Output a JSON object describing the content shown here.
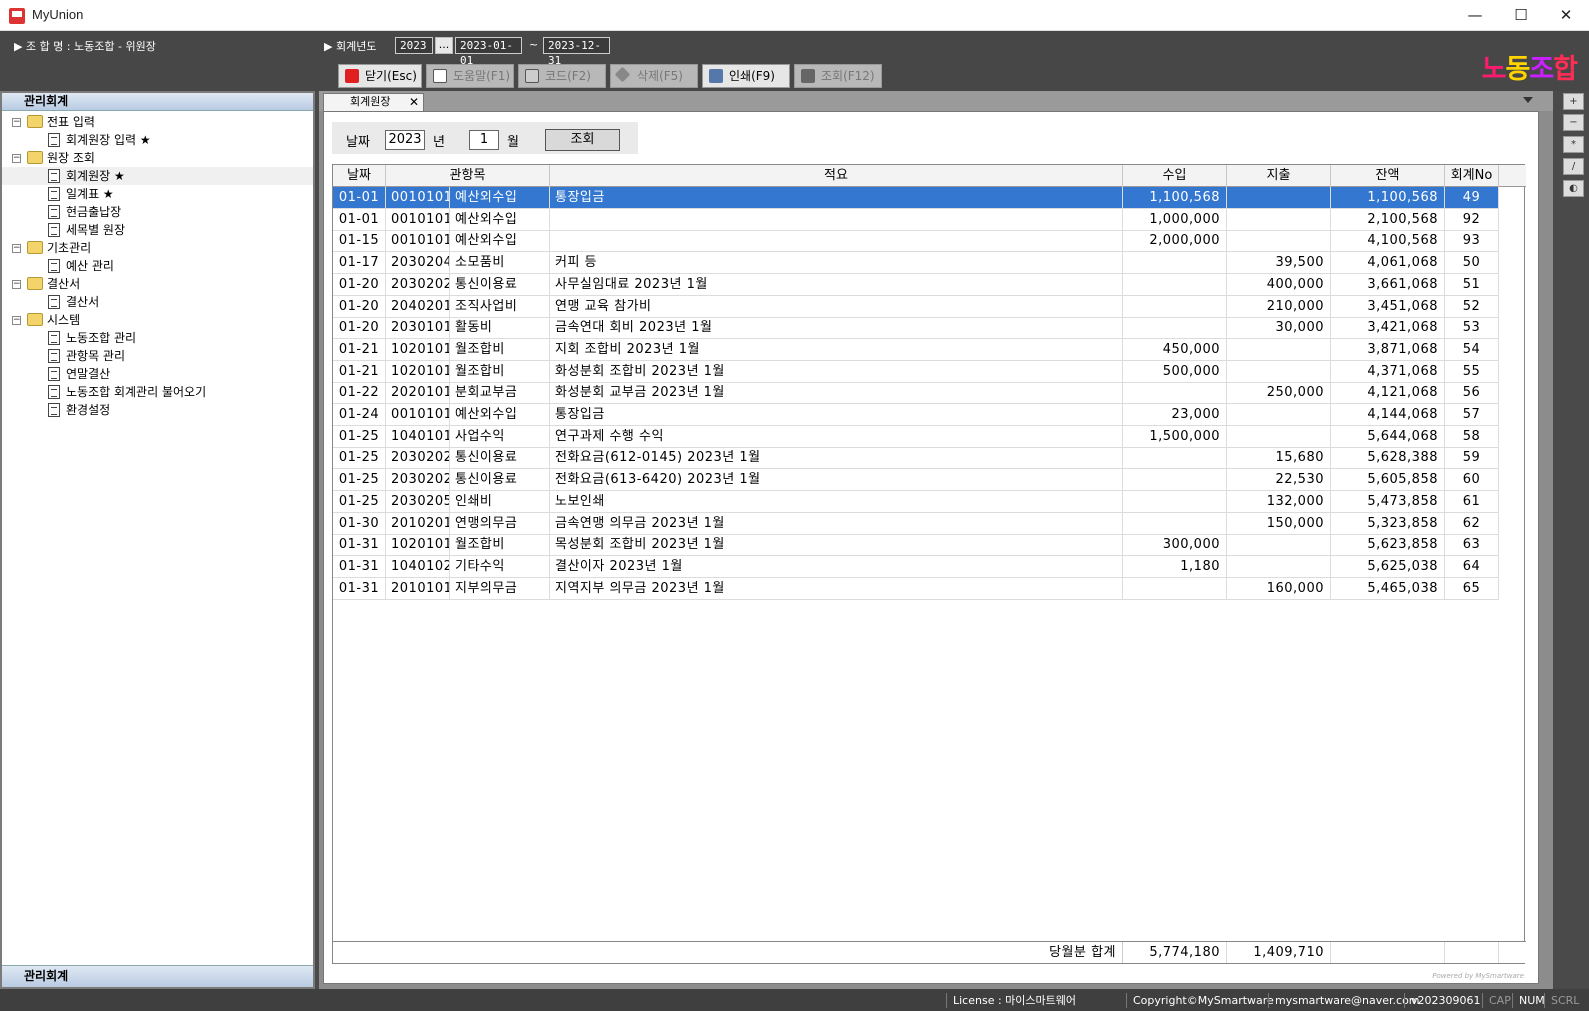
{
  "window": {
    "title": "MyUnion",
    "minimize": "—",
    "maximize": "☐",
    "close": "✕"
  },
  "header": {
    "union_label": "▶ 조 합 명 : 노동조합 - 위원장",
    "fiscal_label": "▶ 회계년도",
    "fiscal_year": "2023",
    "dots": "...",
    "date_from": "2023-01-01",
    "tilde": "~",
    "date_to": "2023-12-31",
    "logo": [
      "노",
      "동",
      "조",
      "합"
    ],
    "logo_colors": [
      "#ff1a6e",
      "#ffd400",
      "#c820ff",
      "#ff2d55"
    ]
  },
  "toolbar": {
    "close": "닫기(Esc)",
    "help": "도움말(F1)",
    "code": "코드(F2)",
    "delete": "삭제(F5)",
    "print": "인쇄(F9)",
    "query": "조회(F12)"
  },
  "sidebar": {
    "title": "관리회계",
    "footer": "관리회계",
    "tree": [
      {
        "label": "전표 입력",
        "type": "folder",
        "level": 0
      },
      {
        "label": "회계원장 입력 ★",
        "type": "doc",
        "level": 1
      },
      {
        "label": "원장 조회",
        "type": "folder",
        "level": 0
      },
      {
        "label": "회계원장 ★",
        "type": "doc",
        "level": 1,
        "selected": true
      },
      {
        "label": "일계표 ★",
        "type": "doc",
        "level": 1
      },
      {
        "label": "현금출납장",
        "type": "doc",
        "level": 1
      },
      {
        "label": "세목별 원장",
        "type": "doc",
        "level": 1
      },
      {
        "label": "기초관리",
        "type": "folder",
        "level": 0
      },
      {
        "label": "예산 관리",
        "type": "doc",
        "level": 1
      },
      {
        "label": "결산서",
        "type": "folder",
        "level": 0
      },
      {
        "label": "결산서",
        "type": "doc",
        "level": 1
      },
      {
        "label": "시스템",
        "type": "folder",
        "level": 0
      },
      {
        "label": "노동조합 관리",
        "type": "doc",
        "level": 1
      },
      {
        "label": "관항목 관리",
        "type": "doc",
        "level": 1
      },
      {
        "label": "연말결산",
        "type": "doc",
        "level": 1
      },
      {
        "label": "노동조합 회계관리 불어오기",
        "type": "doc",
        "level": 1
      },
      {
        "label": "환경설정",
        "type": "doc",
        "level": 1
      }
    ]
  },
  "tab": {
    "label": "회계원장",
    "close": "✕"
  },
  "filter": {
    "date_label": "날짜",
    "year": "2023",
    "year_unit": "년",
    "month": "1",
    "month_unit": "월",
    "query_button": "조회"
  },
  "grid": {
    "columns": [
      "날짜",
      "관항목",
      "적요",
      "수입",
      "지출",
      "잔액",
      "회계No"
    ],
    "rows": [
      [
        "01-01",
        "0010101",
        "예산외수입",
        "통장입금",
        "1,100,568",
        "",
        "1,100,568",
        "49"
      ],
      [
        "01-01",
        "0010101",
        "예산외수입",
        "",
        "1,000,000",
        "",
        "2,100,568",
        "92"
      ],
      [
        "01-15",
        "0010101",
        "예산외수입",
        "",
        "2,000,000",
        "",
        "4,100,568",
        "93"
      ],
      [
        "01-17",
        "2030204",
        "소모품비",
        "커피 등",
        "",
        "39,500",
        "4,061,068",
        "50"
      ],
      [
        "01-20",
        "2030202",
        "통신이용료",
        "사무실임대료 2023년 1월",
        "",
        "400,000",
        "3,661,068",
        "51"
      ],
      [
        "01-20",
        "2040201",
        "조직사업비",
        "연맹 교육 참가비",
        "",
        "210,000",
        "3,451,068",
        "52"
      ],
      [
        "01-20",
        "2030101",
        "활동비",
        "금속연대 회비 2023년 1월",
        "",
        "30,000",
        "3,421,068",
        "53"
      ],
      [
        "01-21",
        "1020101",
        "월조합비",
        "지회 조합비 2023년 1월",
        "450,000",
        "",
        "3,871,068",
        "54"
      ],
      [
        "01-21",
        "1020101",
        "월조합비",
        "화성분회 조합비 2023년 1월",
        "500,000",
        "",
        "4,371,068",
        "55"
      ],
      [
        "01-22",
        "2020101",
        "분회교부금",
        "화성분회 교부금 2023년 1월",
        "",
        "250,000",
        "4,121,068",
        "56"
      ],
      [
        "01-24",
        "0010101",
        "예산외수입",
        "통장입금",
        "23,000",
        "",
        "4,144,068",
        "57"
      ],
      [
        "01-25",
        "1040101",
        "사업수익",
        "연구과제 수행 수익",
        "1,500,000",
        "",
        "5,644,068",
        "58"
      ],
      [
        "01-25",
        "2030202",
        "통신이용료",
        "전화요금(612-0145) 2023년 1월",
        "",
        "15,680",
        "5,628,388",
        "59"
      ],
      [
        "01-25",
        "2030202",
        "통신이용료",
        "전화요금(613-6420) 2023년 1월",
        "",
        "22,530",
        "5,605,858",
        "60"
      ],
      [
        "01-25",
        "2030205",
        "인쇄비",
        "노보인쇄",
        "",
        "132,000",
        "5,473,858",
        "61"
      ],
      [
        "01-30",
        "2010201",
        "연맹의무금",
        "금속연맹 의무금 2023년 1월",
        "",
        "150,000",
        "5,323,858",
        "62"
      ],
      [
        "01-31",
        "1020101",
        "월조합비",
        "목성분회 조합비 2023년 1월",
        "300,000",
        "",
        "5,623,858",
        "63"
      ],
      [
        "01-31",
        "1040102",
        "기타수익",
        "결산이자 2023년 1월",
        "1,180",
        "",
        "5,625,038",
        "64"
      ],
      [
        "01-31",
        "2010101",
        "지부의무금",
        "지역지부 의무금 2023년 1월",
        "",
        "160,000",
        "5,465,038",
        "65"
      ]
    ],
    "footer": {
      "label": "당월분 합계",
      "income": "5,774,180",
      "expense": "1,409,710"
    },
    "powered": "Powered by MySmartware"
  },
  "sidetools": [
    "+",
    "−",
    "*",
    "/",
    "◐"
  ],
  "status": {
    "license": "License : 마이스마트웨어",
    "copyright": "Copyright©MySmartware",
    "email": "mysmartware@naver.com",
    "version": "v202309061",
    "cap": "CAP",
    "num": "NUM",
    "scrl": "SCRL"
  }
}
